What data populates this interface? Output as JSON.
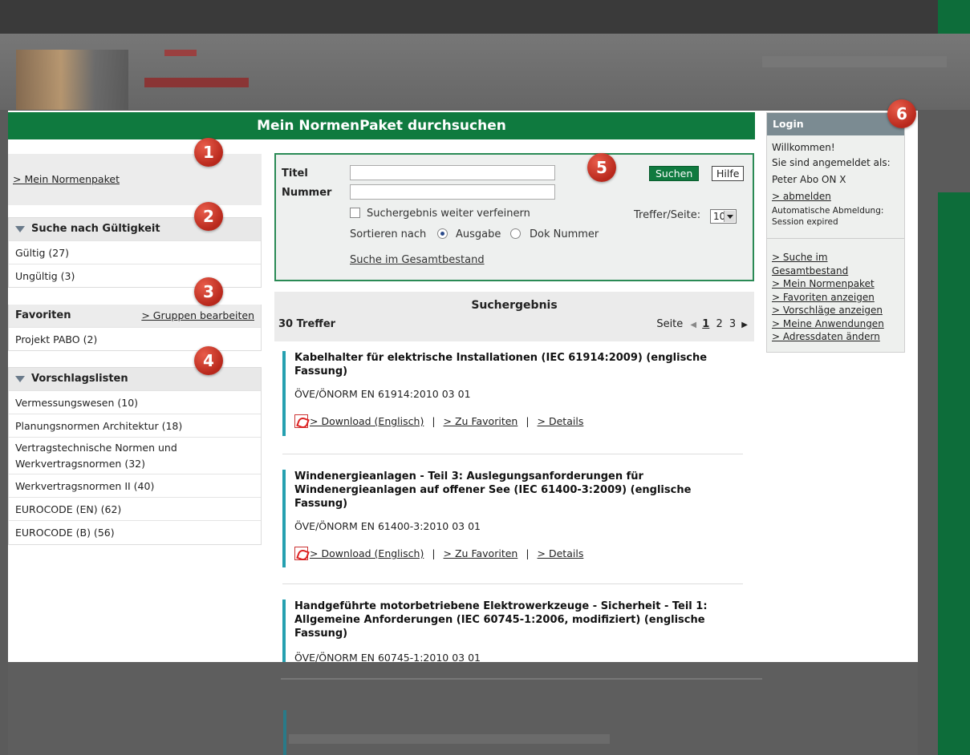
{
  "page": {
    "title": "Mein NormenPaket durchsuchen"
  },
  "left": {
    "mein_link": "> Mein Normenpaket",
    "gueltigkeit": {
      "heading": "Suche nach Gültigkeit",
      "items": [
        "Gültig (27)",
        "Ungültig (3)"
      ]
    },
    "favoriten": {
      "heading": "Favoriten",
      "edit_link": "> Gruppen bearbeiten",
      "items": [
        "Projekt PABO (2)"
      ]
    },
    "vorschlag": {
      "heading": "Vorschlagslisten",
      "items": [
        "Vermessungswesen (10)",
        "Planungsnormen Architektur (18)",
        "Vertragstechnische Normen und Werkvertragsnormen (32)",
        "Werkvertragsnormen II (40)",
        "EUROCODE (EN) (62)",
        "EUROCODE (B) (56)"
      ]
    }
  },
  "search": {
    "title_label": "Titel",
    "title_value": "",
    "number_label": "Nummer",
    "number_value": "",
    "search_button": "Suchen",
    "help_button": "Hilfe",
    "refine_label": "Suchergebnis weiter verfeinern",
    "hits_per_page_label": "Treffer/Seite:",
    "hits_per_page_value": "10",
    "sort_label": "Sortieren nach",
    "sort_option_1": "Ausgabe",
    "sort_option_2": "Dok Nummer",
    "sort_selected": "Ausgabe",
    "global_link": "Suche im Gesamtbestand"
  },
  "results": {
    "heading": "Suchergebnis",
    "count": "30 Treffer",
    "page_label": "Seite",
    "pages": [
      "1",
      "2",
      "3"
    ],
    "current_page": "1",
    "action_download": "> Download (Englisch)",
    "action_favorite": "> Zu Favoriten",
    "action_details": "> Details",
    "action_sep": "|",
    "items": [
      {
        "title": "Kabelhalter für elektrische Installationen (IEC 61914:2009) (englische Fassung)",
        "number": "ÖVE/ÖNORM EN 61914:2010 03 01"
      },
      {
        "title": "Windenergieanlagen - Teil 3: Auslegungsanforderungen für Windenergieanlagen auf offener See (IEC 61400-3:2009) (englische Fassung)",
        "number": "ÖVE/ÖNORM EN 61400-3:2010 03 01"
      },
      {
        "title": "Handgeführte motorbetriebene Elektrowerkzeuge - Sicherheit - Teil 1: Allgemeine Anforderungen (IEC 60745-1:2006, modifiziert) (englische Fassung)",
        "number": "ÖVE/ÖNORM EN 60745-1:2010 03 01"
      }
    ]
  },
  "login": {
    "heading": "Login",
    "welcome": "Willkommen!",
    "logged_in_as": "Sie sind angemeldet als:",
    "user": "Peter Abo ON X",
    "logout": "> abmelden",
    "auto_logout_1": "Automatische Abmeldung:",
    "auto_logout_2": "Session expired",
    "links": [
      "> Suche im Gesamtbestand",
      "> Mein Normenpaket",
      "> Favoriten anzeigen",
      "> Vorschläge anzeigen",
      "> Meine Anwendungen",
      "> Adressdaten ändern"
    ]
  },
  "markers": [
    "1",
    "2",
    "3",
    "4",
    "5",
    "6"
  ],
  "colors": {
    "brand_green": "#0f7a3f",
    "accent_teal": "#25a0b0",
    "marker_red": "#c8321f",
    "login_header": "#7b8b92"
  }
}
